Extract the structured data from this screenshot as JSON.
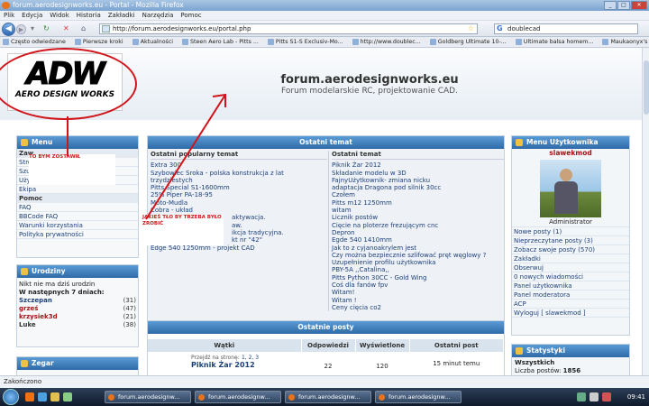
{
  "browser": {
    "title": "forum.aerodesignworks.eu - Portal - Mozilla Firefox",
    "menu": [
      "Plik",
      "Edycja",
      "Widok",
      "Historia",
      "Zakładki",
      "Narzędzia",
      "Pomoc"
    ],
    "url": "http://forum.aerodesignworks.eu/portal.php",
    "search_value": "doublecad",
    "bookmarks": [
      "Często odwiedzane",
      "Pierwsze kroki",
      "Aktualności",
      "Steen Aero Lab - Pitts ...",
      "Pitts S1-S Exclusiv-Mo...",
      "http://www.doublec...",
      "Goldberg Ultimate 10-...",
      "Ultimate balsa homem...",
      "Maukaonyx's \"Life is G..."
    ],
    "status": "Zakończono"
  },
  "site": {
    "logo_big": "ADW",
    "logo_small": "AERO DESIGN WORKS",
    "title": "forum.aerodesignworks.eu",
    "subtitle": "Forum modelarskie RC, projektowanie CAD."
  },
  "menu_box": {
    "title": "Menu",
    "items": [
      {
        "label": "Zaw",
        "type": "head"
      },
      {
        "label": "Stro",
        "type": "item"
      },
      {
        "label": "Szuk",
        "type": "item"
      },
      {
        "label": "Użytkownicy",
        "type": "item"
      },
      {
        "label": "Ekipa",
        "type": "item"
      },
      {
        "label": "Pomoc",
        "type": "head"
      },
      {
        "label": "FAQ",
        "type": "item"
      },
      {
        "label": "BBCode FAQ",
        "type": "item"
      },
      {
        "label": "Warunki korzystania",
        "type": "item"
      },
      {
        "label": "Polityka prywatności",
        "type": "item"
      }
    ]
  },
  "annotations": {
    "a1": "TO BYM ZOSTAWIŁ",
    "a2": "JAKIEŚ TŁO BY TRZEBA BYŁO ZROBIĆ"
  },
  "birthdays": {
    "title": "Urodziny",
    "today": "Nikt nie ma dziś urodzin",
    "next_label": "W następnych 7 dniach:",
    "people": [
      {
        "name": "Szczepan",
        "age": "(31)"
      },
      {
        "name": "grześ",
        "age": "(47)"
      },
      {
        "name": "krzysiek3d",
        "age": "(21)"
      },
      {
        "name": "Luke",
        "age": "(38)"
      }
    ]
  },
  "clock_box": {
    "title": "Zegar"
  },
  "recent": {
    "title": "Ostatni temat",
    "left_header": "Ostatni popularny temat",
    "left": [
      "Extra 300",
      "Szybowiec Sroka - polska konstrukcja z lat trzydziestych",
      "Pitts Special S1-1600mm",
      "25% Piper PA-18-95",
      "Moto-Mudla",
      "Cobra - układ",
      "aktywacja.",
      "aw.",
      "ikcja tradycyjna.",
      "kt nr \"42\"",
      "Edge 540 1250mm - projekt CAD"
    ],
    "right_header": "Ostatni temat",
    "right": [
      "Piknik Żar 2012",
      "Składanie modelu w 3D",
      "FajnyUżytkownik- zmiana nicku",
      "adaptacja Dragona pod silnik 30cc",
      "Czołem",
      "Pitts m12 1250mm",
      "witam",
      "Licznik postów",
      "Cięcie na ploterze frezującym cnc",
      "Depron",
      "Egde 540 1410mm",
      "Jak to z cyjanoakrylem jest",
      "Czy można bezpiecznie szlifować pręt węglowy ?",
      "Uzupełnienie profilu użytkownika",
      "PBY-5A ,,Catalina,,",
      "Pitts Python 30CC - Gold Wing",
      "Coś dla fanów fpv",
      "Witam!",
      "Witam !",
      "Ceny cięcia co2"
    ]
  },
  "posts": {
    "title": "Ostatnie posty",
    "headers": [
      "Wątki",
      "Odpowiedzi",
      "Wyświetlone",
      "Ostatni post"
    ],
    "pages_label": "Przejdź na stronę:",
    "pages": "1, 2, 3",
    "row_title": "Piknik Żar 2012",
    "replies": "22",
    "views": "120",
    "last": "15 minut temu"
  },
  "user": {
    "title": "Menu Użytkownika",
    "name": "slawekmod",
    "role": "Administrator",
    "items": [
      "Nowe posty (1)",
      "Nieprzeczytane posty (3)",
      "Zobacz swoje posty (570)",
      "Zakładki",
      "Obserwuj",
      "0 nowych wiadomości",
      "Panel użytkownika",
      "Panel moderatora",
      "ACP",
      "Wyloguj [ slawekmod ]"
    ]
  },
  "stats": {
    "title": "Statystyki",
    "label": "Wszystkich",
    "posts_label": "Liczba postów:",
    "posts": "1856"
  },
  "taskbar": {
    "tasks": [
      "forum.aerodesignw...",
      "forum.aerodesignw...",
      "forum.aerodesignw...",
      "forum.aerodesignw..."
    ],
    "time": "09:41"
  }
}
